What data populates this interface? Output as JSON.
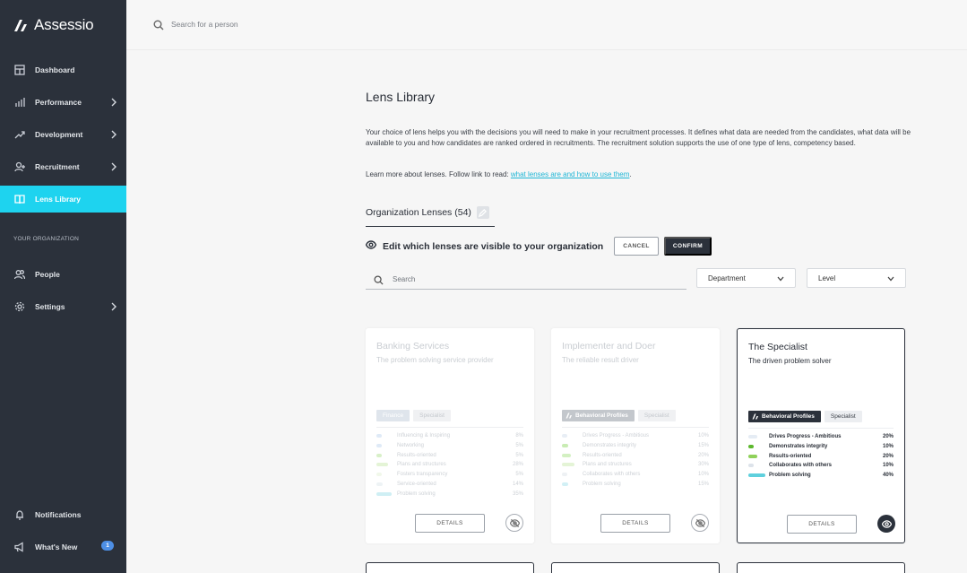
{
  "brand": {
    "name": "Assessio"
  },
  "sidebar": {
    "items": [
      {
        "label": "Dashboard"
      },
      {
        "label": "Performance"
      },
      {
        "label": "Development"
      },
      {
        "label": "Recruitment"
      },
      {
        "label": "Lens Library"
      },
      {
        "label": "People"
      },
      {
        "label": "Settings"
      },
      {
        "label": "Notifications"
      },
      {
        "label": "What's New",
        "badge": "1"
      }
    ],
    "section_label": "YOUR ORGANIZATION"
  },
  "topbar": {
    "search_placeholder": "Search for a person"
  },
  "page": {
    "title": "Lens Library",
    "description": "Your choice of lens helps you with the decisions you will need to make in your recruitment processes. It defines what data are needed from the candidates, what data will be available to you and how candidates are ranked ordered in recruitments. The recruitment solution supports the use of one type of lens, competency based.",
    "learn_prefix": "Learn more about lenses. Follow link to read: ",
    "learn_link": "what lenses are and how to use them",
    "learn_suffix": ".",
    "tab_label": "Organization Lenses (54)",
    "visibility_text": "Edit which lenses are visible to your organization",
    "cancel_label": "CANCEL",
    "confirm_label": "CONFIRM",
    "search_placeholder": "Search",
    "department_label": "Department",
    "level_label": "Level"
  },
  "cards": [
    {
      "title": "Banking Services",
      "subtitle": "The problem solving service provider",
      "dept_tag": "Finance",
      "level_tag": "Specialist",
      "details_label": "DETAILS",
      "competencies": [
        {
          "name": "Influencing & Inspiring",
          "pct": "8%",
          "pct_value": 8,
          "color": "#dfeaf7"
        },
        {
          "name": "Networking",
          "pct": "5%",
          "pct_value": 5,
          "color": "#dfeaf7"
        },
        {
          "name": "Results-oriented",
          "pct": "5%",
          "pct_value": 5,
          "color": "#d8f0c8"
        },
        {
          "name": "Plans and structures",
          "pct": "28%",
          "pct_value": 28,
          "color": "#e4f4d6"
        },
        {
          "name": "Fosters transparency",
          "pct": "5%",
          "pct_value": 5,
          "color": "#f1f8ea"
        },
        {
          "name": "Service-oriented",
          "pct": "14%",
          "pct_value": 14,
          "color": "#eef3f5"
        },
        {
          "name": "Problem solving",
          "pct": "35%",
          "pct_value": 35,
          "color": "#cfeff4"
        }
      ]
    },
    {
      "title": "Implementer and Doer",
      "subtitle": "The reliable result driver",
      "dept_tag": "Behavioral Profiles",
      "level_tag": "Specialist",
      "details_label": "DETAILS",
      "competencies": [
        {
          "name": "Drives Progress - Ambitious",
          "pct": "10%",
          "pct_value": 10,
          "color": "#e8eef5"
        },
        {
          "name": "Demonstrates integrity",
          "pct": "15%",
          "pct_value": 15,
          "color": "#c9ecb4"
        },
        {
          "name": "Results-oriented",
          "pct": "20%",
          "pct_value": 20,
          "color": "#d3f0c2"
        },
        {
          "name": "Plans and structures",
          "pct": "30%",
          "pct_value": 30,
          "color": "#e4f4d6"
        },
        {
          "name": "Collaborates with others",
          "pct": "10%",
          "pct_value": 10,
          "color": "#eef1f4"
        },
        {
          "name": "Problem solving",
          "pct": "15%",
          "pct_value": 15,
          "color": "#d2f0f5"
        }
      ]
    },
    {
      "title": "The Specialist",
      "subtitle": "The driven problem solver",
      "dept_tag": "Behavioral Profiles",
      "level_tag": "Specialist",
      "details_label": "DETAILS",
      "competencies": [
        {
          "name": "Drives Progress - Ambitious",
          "pct": "20%",
          "pct_value": 20,
          "color": "#e5ecf4"
        },
        {
          "name": "Demonstrates integrity",
          "pct": "10%",
          "pct_value": 10,
          "color": "#5cb82e"
        },
        {
          "name": "Results-oriented",
          "pct": "20%",
          "pct_value": 20,
          "color": "#8fd15a"
        },
        {
          "name": "Collaborates with others",
          "pct": "10%",
          "pct_value": 10,
          "color": "#dde3ea"
        },
        {
          "name": "Problem solving",
          "pct": "40%",
          "pct_value": 40,
          "color": "#5fd0dd"
        }
      ]
    }
  ]
}
